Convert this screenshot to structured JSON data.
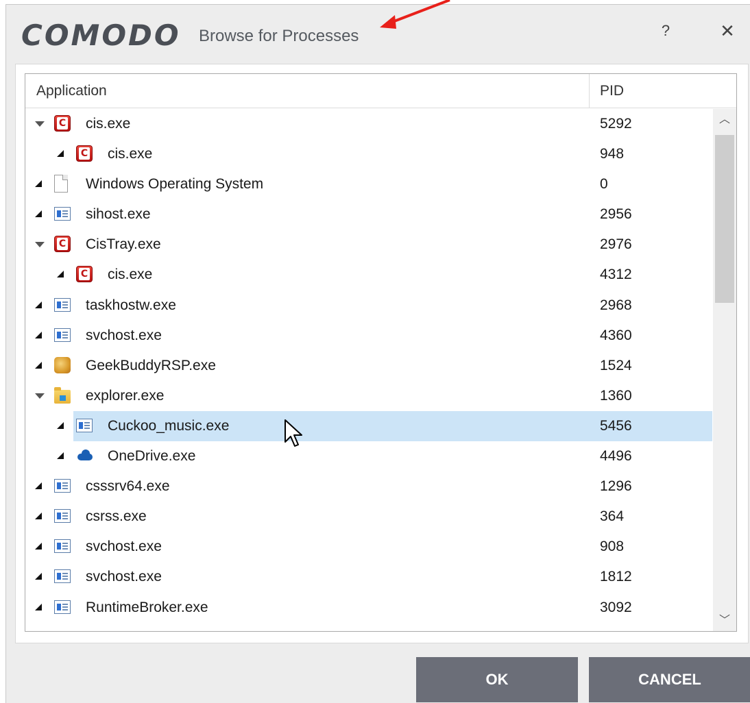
{
  "dialog": {
    "brand": "COMODO",
    "title": "Browse for Processes",
    "help_label": "?",
    "close_label": "✕",
    "accent_color": "#e8201a"
  },
  "table": {
    "columns": {
      "application": "Application",
      "pid": "PID"
    },
    "rows": [
      {
        "name": "cis.exe",
        "pid": "5292",
        "icon": "comodo-icon",
        "level": 0,
        "expander": "expanded"
      },
      {
        "name": "cis.exe",
        "pid": "948",
        "icon": "comodo-icon",
        "level": 1,
        "expander": "collapsed"
      },
      {
        "name": "Windows Operating System",
        "pid": "0",
        "icon": "document-icon",
        "level": 0,
        "expander": "collapsed"
      },
      {
        "name": "sihost.exe",
        "pid": "2956",
        "icon": "application-icon",
        "level": 0,
        "expander": "collapsed"
      },
      {
        "name": "CisTray.exe",
        "pid": "2976",
        "icon": "comodo-icon",
        "level": 0,
        "expander": "expanded"
      },
      {
        "name": "cis.exe",
        "pid": "4312",
        "icon": "comodo-icon",
        "level": 1,
        "expander": "collapsed"
      },
      {
        "name": "taskhostw.exe",
        "pid": "2968",
        "icon": "application-icon",
        "level": 0,
        "expander": "collapsed"
      },
      {
        "name": "svchost.exe",
        "pid": "4360",
        "icon": "application-icon",
        "level": 0,
        "expander": "collapsed"
      },
      {
        "name": "GeekBuddyRSP.exe",
        "pid": "1524",
        "icon": "geekbuddy-icon",
        "level": 0,
        "expander": "collapsed"
      },
      {
        "name": "explorer.exe",
        "pid": "1360",
        "icon": "folder-icon",
        "level": 0,
        "expander": "expanded"
      },
      {
        "name": "Cuckoo_music.exe",
        "pid": "5456",
        "icon": "application-icon",
        "level": 1,
        "expander": "collapsed",
        "selected": true
      },
      {
        "name": "OneDrive.exe",
        "pid": "4496",
        "icon": "onedrive-cloud-icon",
        "level": 1,
        "expander": "collapsed"
      },
      {
        "name": "csssrv64.exe",
        "pid": "1296",
        "icon": "application-icon",
        "level": 0,
        "expander": "collapsed"
      },
      {
        "name": "csrss.exe",
        "pid": "364",
        "icon": "application-icon",
        "level": 0,
        "expander": "collapsed"
      },
      {
        "name": "svchost.exe",
        "pid": "908",
        "icon": "application-icon",
        "level": 0,
        "expander": "collapsed"
      },
      {
        "name": "svchost.exe",
        "pid": "1812",
        "icon": "application-icon",
        "level": 0,
        "expander": "collapsed"
      },
      {
        "name": "RuntimeBroker.exe",
        "pid": "3092",
        "icon": "application-icon",
        "level": 0,
        "expander": "collapsed"
      }
    ],
    "selection_color": "#cce4f7"
  },
  "buttons": {
    "ok": "OK",
    "cancel": "CANCEL",
    "color": "#6b6e78"
  }
}
